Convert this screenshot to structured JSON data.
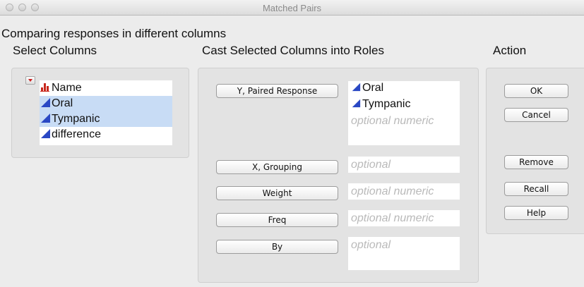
{
  "window": {
    "title": "Matched Pairs"
  },
  "header": {
    "subtitle": "Comparing responses in different columns"
  },
  "select_columns": {
    "heading": "Select Columns",
    "items": [
      {
        "label": "Name",
        "icon": "nominal-bar-chart-icon",
        "selected": false
      },
      {
        "label": "Oral",
        "icon": "continuous-triangle-icon",
        "selected": true
      },
      {
        "label": "Tympanic",
        "icon": "continuous-triangle-icon",
        "selected": true
      },
      {
        "label": "difference",
        "icon": "continuous-triangle-icon",
        "selected": false
      }
    ]
  },
  "roles": {
    "heading": "Cast Selected Columns into Roles",
    "y": {
      "button": "Y, Paired Response",
      "values": [
        "Oral",
        "Tympanic"
      ],
      "placeholder": "optional numeric"
    },
    "x": {
      "button": "X, Grouping",
      "placeholder": "optional"
    },
    "weight": {
      "button": "Weight",
      "placeholder": "optional numeric"
    },
    "freq": {
      "button": "Freq",
      "placeholder": "optional numeric"
    },
    "by": {
      "button": "By",
      "placeholder": "optional"
    }
  },
  "action": {
    "heading": "Action",
    "ok": "OK",
    "cancel": "Cancel",
    "remove": "Remove",
    "recall": "Recall",
    "help": "Help"
  },
  "colors": {
    "selection": "#c8dcf5",
    "nominal_icon": "#c8281e",
    "continuous_icon": "#2a48c4",
    "placeholder_text": "#b9b9b9"
  }
}
